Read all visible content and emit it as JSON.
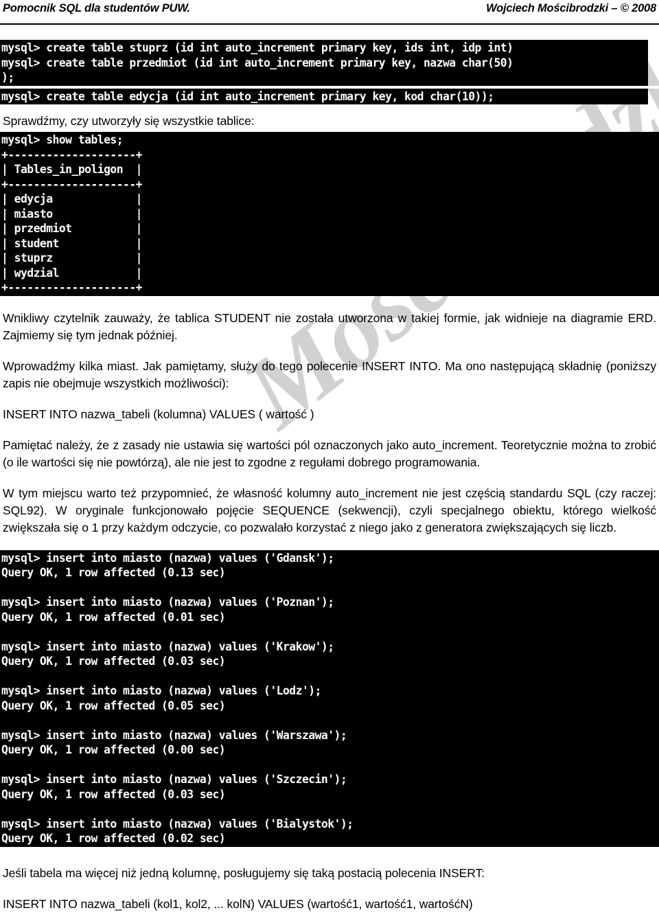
{
  "header": {
    "left": "Pomocnik SQL dla studentów PUW.",
    "right": "Wojciech Mościbrodzki – © 2008"
  },
  "watermark": {
    "text": "Mościbrodzki",
    "color": "#c9c9c9"
  },
  "terminal_top_a": "mysql> create table stuprz (id int auto_increment primary key, ids int, idp int)\nmysql> create table przedmiot (id int auto_increment primary key, nazwa char(50)\n);",
  "terminal_top_b": "mysql> create table edycja (id int auto_increment primary key, kod char(10));",
  "intro_line": "Sprawdźmy, czy utworzyły się wszystkie tablice:",
  "terminal_show_tables": "mysql> show tables;\n+--------------------+\n| Tables_in_poligon  |\n+--------------------+\n| edycja             |\n| miasto             |\n| przedmiot          |\n| student            |\n| stuprz             |\n| wydzial            |\n+--------------------+",
  "paragraphs": {
    "p1": "Wnikliwy czytelnik zauważy, że tablica STUDENT nie została utworzona w takiej formie, jak widnieje na diagramie ERD. Zajmiemy się tym jednak później.",
    "p2": "Wprowadźmy kilka miast. Jak pamiętamy, służy do tego polecenie INSERT INTO. Ma ono następującą składnię (poniższy zapis nie obejmuje wszystkich możliwości):",
    "syntax1": "INSERT INTO nazwa_tabeli (kolumna) VALUES ( wartość )",
    "p3": "Pamiętać należy, że z zasady nie ustawia się wartości pól oznaczonych jako auto_increment. Teoretycznie można to zrobić (o ile wartości się nie powtórzą), ale nie jest to zgodne z regułami dobrego programowania.",
    "p4": "W tym miejscu warto też przypomnieć, że własność kolumny auto_increment nie jest częścią standardu SQL (czy raczej: SQL92). W oryginale funkcjonowało pojęcie SEQUENCE (sekwencji), czyli specjalnego obiektu, którego wielkość zwiększała się o 1 przy każdym odczycie, co pozwalało korzystać z niego jako z generatora zwiększających się liczb.",
    "p5": "Jeśli tabela ma więcej niż jedną kolumnę, posługujemy się taką postacią polecenia INSERT:",
    "syntax2": "INSERT INTO nazwa_tabeli (kol1, kol2, ... kolN) VALUES (wartość1, wartość1, wartośćN)"
  },
  "terminal_inserts": "mysql> insert into miasto (nazwa) values ('Gdansk');\nQuery OK, 1 row affected (0.13 sec)\n\nmysql> insert into miasto (nazwa) values ('Poznan');\nQuery OK, 1 row affected (0.01 sec)\n\nmysql> insert into miasto (nazwa) values ('Krakow');\nQuery OK, 1 row affected (0.03 sec)\n\nmysql> insert into miasto (nazwa) values ('Lodz');\nQuery OK, 1 row affected (0.05 sec)\n\nmysql> insert into miasto (nazwa) values ('Warszawa');\nQuery OK, 1 row affected (0.00 sec)\n\nmysql> insert into miasto (nazwa) values ('Szczecin');\nQuery OK, 1 row affected (0.03 sec)\n\nmysql> insert into miasto (nazwa) values ('Bialystok');\nQuery OK, 1 row affected (0.02 sec)"
}
